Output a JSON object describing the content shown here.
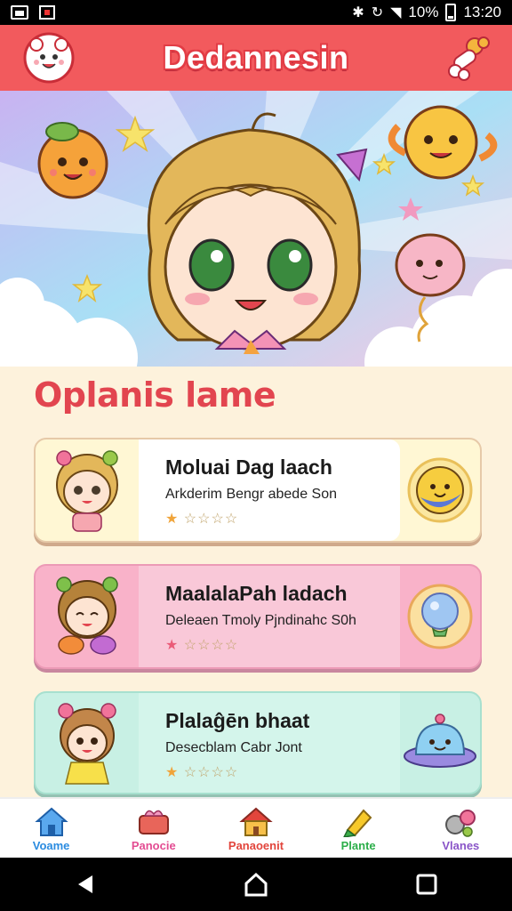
{
  "status_bar": {
    "battery": "10%",
    "time": "13:20"
  },
  "app": {
    "title": "Dedannesin"
  },
  "section": {
    "title": "Oplanis lame"
  },
  "cards": [
    {
      "title": "Moluai Dag laach",
      "subtitle": "Arkderim Bengr abede Son",
      "rating": 1,
      "max_rating": 5,
      "accent": "#fff7d4"
    },
    {
      "title": "MaalalaPah ladach",
      "subtitle": "Deleaen Tmoly Pjndinahc S0h",
      "rating": 1,
      "max_rating": 5,
      "accent": "#f9b2c9"
    },
    {
      "title": "Plalaĝēn bhaat",
      "subtitle": "Desecblam Cabr Jont",
      "rating": 1,
      "max_rating": 5,
      "accent": "#c8f0e4"
    }
  ],
  "nav": [
    {
      "label": "Voame",
      "icon": "home-icon",
      "color": "#2a8be0"
    },
    {
      "label": "Panocie",
      "icon": "treat-box-icon",
      "color": "#e34c92"
    },
    {
      "label": "Panaoenit",
      "icon": "house-icon",
      "color": "#e2453c"
    },
    {
      "label": "Plante",
      "icon": "crayon-icon",
      "color": "#2cae4a"
    },
    {
      "label": "Vlanes",
      "icon": "critters-icon",
      "color": "#8a55c8"
    }
  ],
  "system_nav": {
    "back": "back-icon",
    "home": "home-circle-icon",
    "recents": "recents-icon"
  }
}
